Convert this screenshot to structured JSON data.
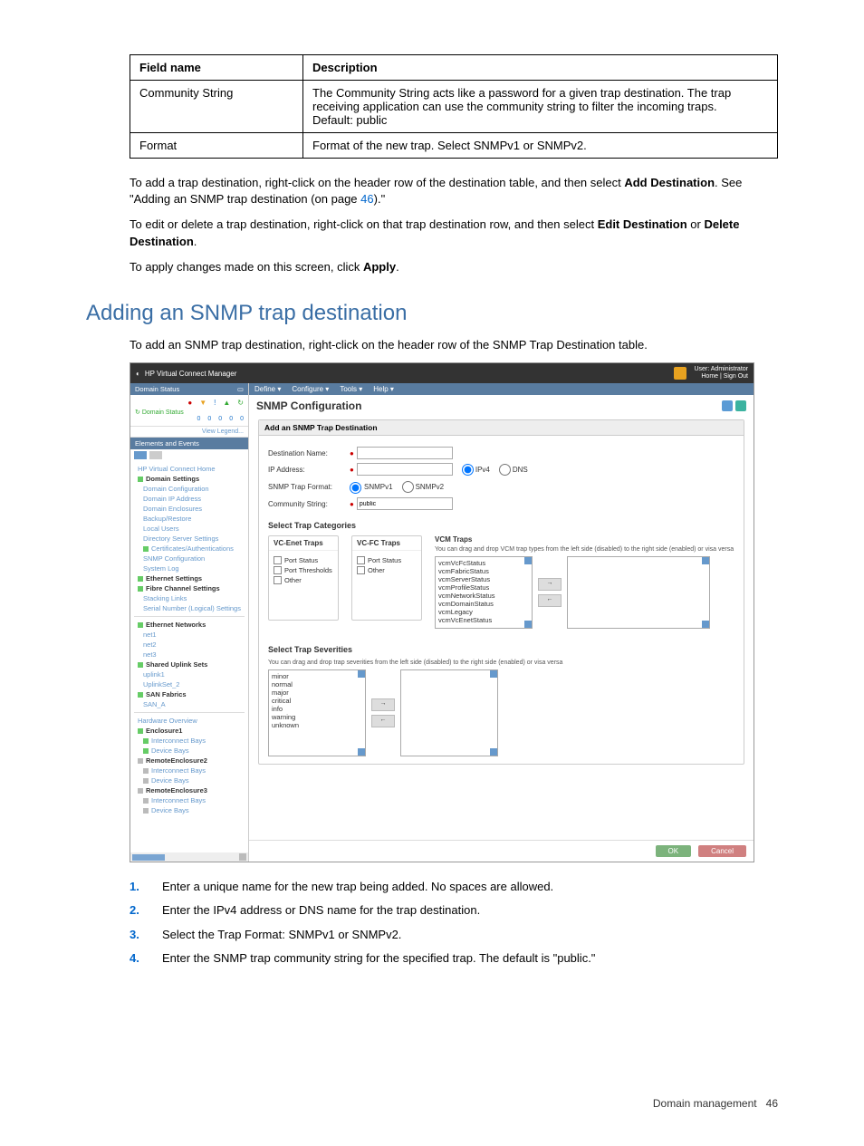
{
  "table": {
    "headers": {
      "field": "Field name",
      "desc": "Description"
    },
    "rows": [
      {
        "field": "Community String",
        "desc": "The Community String acts like a password for a given trap destination. The trap receiving application can use the community string to filter the incoming traps.\nDefault: public"
      },
      {
        "field": "Format",
        "desc": "Format of the new trap. Select SNMPv1 or SNMPv2."
      }
    ]
  },
  "para1a": "To add a trap destination, right-click on the header row of the destination table, and then select ",
  "para1b": "Add Destination",
  "para1c": ". See \"Adding an SNMP trap destination (on page ",
  "para1link": "46",
  "para1d": ").\"",
  "para2a": "To edit or delete a trap destination, right-click on that trap destination row, and then select ",
  "para2b": "Edit Destination",
  "para2c": " or ",
  "para2d": "Delete Destination",
  "para2e": ".",
  "para3a": "To apply changes made on this screen, click ",
  "para3b": "Apply",
  "para3c": ".",
  "section_heading": "Adding an SNMP trap destination",
  "section_intro": "To add an SNMP trap destination, right-click on the header row of the SNMP Trap Destination table.",
  "screenshot": {
    "topbar_title": "HP Virtual Connect Manager",
    "topbar_user_line1": "User: Administrator",
    "topbar_user_line2": "Home | Sign Out",
    "sidebar": {
      "status_title": "Domain Status",
      "status_icons": [
        "●",
        "▼",
        "!",
        "▲",
        "↻"
      ],
      "status_label": "Domain Status",
      "status_nums": [
        "0",
        "0",
        "0",
        "0",
        "0"
      ],
      "view_legend": "View Legend...",
      "elements_title": "Elements and Events",
      "tree": [
        {
          "t": "HP Virtual Connect Home",
          "l": 1
        },
        {
          "t": "Domain Settings",
          "l": 1,
          "sq": "green",
          "bold": true
        },
        {
          "t": "Domain Configuration",
          "l": 2
        },
        {
          "t": "Domain IP Address",
          "l": 2
        },
        {
          "t": "Domain Enclosures",
          "l": 2
        },
        {
          "t": "Backup/Restore",
          "l": 2
        },
        {
          "t": "Local Users",
          "l": 2
        },
        {
          "t": "Directory Server Settings",
          "l": 2
        },
        {
          "t": "Certificates/Authentications",
          "l": 2,
          "sq": "green"
        },
        {
          "t": "SNMP Configuration",
          "l": 2
        },
        {
          "t": "System Log",
          "l": 2
        },
        {
          "t": "Ethernet Settings",
          "l": 1,
          "sq": "green",
          "bold": true
        },
        {
          "t": "Fibre Channel Settings",
          "l": 1,
          "sq": "green",
          "bold": true
        },
        {
          "t": "Stacking Links",
          "l": 2
        },
        {
          "t": "Serial Number (Logical) Settings",
          "l": 2
        },
        {
          "t": "Ethernet Networks",
          "l": 1,
          "sq": "green",
          "bold": true,
          "sep": true
        },
        {
          "t": "net1",
          "l": 2
        },
        {
          "t": "net2",
          "l": 2
        },
        {
          "t": "net3",
          "l": 2
        },
        {
          "t": "Shared Uplink Sets",
          "l": 1,
          "sq": "green",
          "bold": true
        },
        {
          "t": "uplink1",
          "l": 2
        },
        {
          "t": "UplinkSet_2",
          "l": 2
        },
        {
          "t": "SAN Fabrics",
          "l": 1,
          "sq": "green",
          "bold": true
        },
        {
          "t": "SAN_A",
          "l": 2
        },
        {
          "t": "Hardware Overview",
          "l": 1,
          "sep": true
        },
        {
          "t": "Enclosure1",
          "l": 1,
          "sq": "green",
          "bold": true
        },
        {
          "t": "Interconnect Bays",
          "l": 2,
          "sq": "green"
        },
        {
          "t": "Device Bays",
          "l": 2,
          "sq": "green"
        },
        {
          "t": "RemoteEnclosure2",
          "l": 1,
          "sq": "grey",
          "bold": true
        },
        {
          "t": "Interconnect Bays",
          "l": 2,
          "sq": "grey"
        },
        {
          "t": "Device Bays",
          "l": 2,
          "sq": "grey"
        },
        {
          "t": "RemoteEnclosure3",
          "l": 1,
          "sq": "grey",
          "bold": true
        },
        {
          "t": "Interconnect Bays",
          "l": 2,
          "sq": "grey"
        },
        {
          "t": "Device Bays",
          "l": 2,
          "sq": "grey"
        }
      ]
    },
    "menubar": [
      "Define ▾",
      "Configure ▾",
      "Tools ▾",
      "Help ▾"
    ],
    "page_title": "SNMP Configuration",
    "panel_title": "Add an SNMP Trap Destination",
    "form": {
      "dest_label": "Destination Name:",
      "ip_label": "IP Address:",
      "ipv4": "IPv4",
      "dns": "DNS",
      "format_label": "SNMP Trap Format:",
      "snmpv1": "SNMPv1",
      "snmpv2": "SNMPv2",
      "comm_label": "Community String:",
      "comm_value": "public"
    },
    "cats_title": "Select Trap Categories",
    "enet_title": "VC-Enet Traps",
    "enet_items": [
      "Port Status",
      "Port Thresholds",
      "Other"
    ],
    "fc_title": "VC-FC Traps",
    "fc_items": [
      "Port Status",
      "Other"
    ],
    "vcm_title": "VCM Traps",
    "vcm_hint": "You can drag and drop VCM trap types from the left side (disabled) to the right side (enabled) or visa versa",
    "vcm_left": [
      "vcmVcFcStatus",
      "vcmFabricStatus",
      "vcmServerStatus",
      "vcmProfileStatus",
      "vcmNetworkStatus",
      "vcmDomainStatus",
      "vcmLegacy",
      "vcmVcEnetStatus"
    ],
    "sev_title": "Select Trap Severities",
    "sev_hint": "You can drag and drop trap severities from the left side (disabled) to the right side (enabled) or visa versa",
    "sev_left": [
      "minor",
      "normal",
      "major",
      "critical",
      "info",
      "warning",
      "unknown"
    ],
    "ok": "OK",
    "cancel": "Cancel"
  },
  "steps": [
    "Enter a unique name for the new trap being added. No spaces are allowed.",
    "Enter the IPv4 address or DNS name for the trap destination.",
    "Select the Trap Format: SNMPv1 or SNMPv2.",
    "Enter the SNMP trap community string for the specified trap. The default is \"public.\""
  ],
  "footer": {
    "section": "Domain management",
    "page": "46"
  }
}
